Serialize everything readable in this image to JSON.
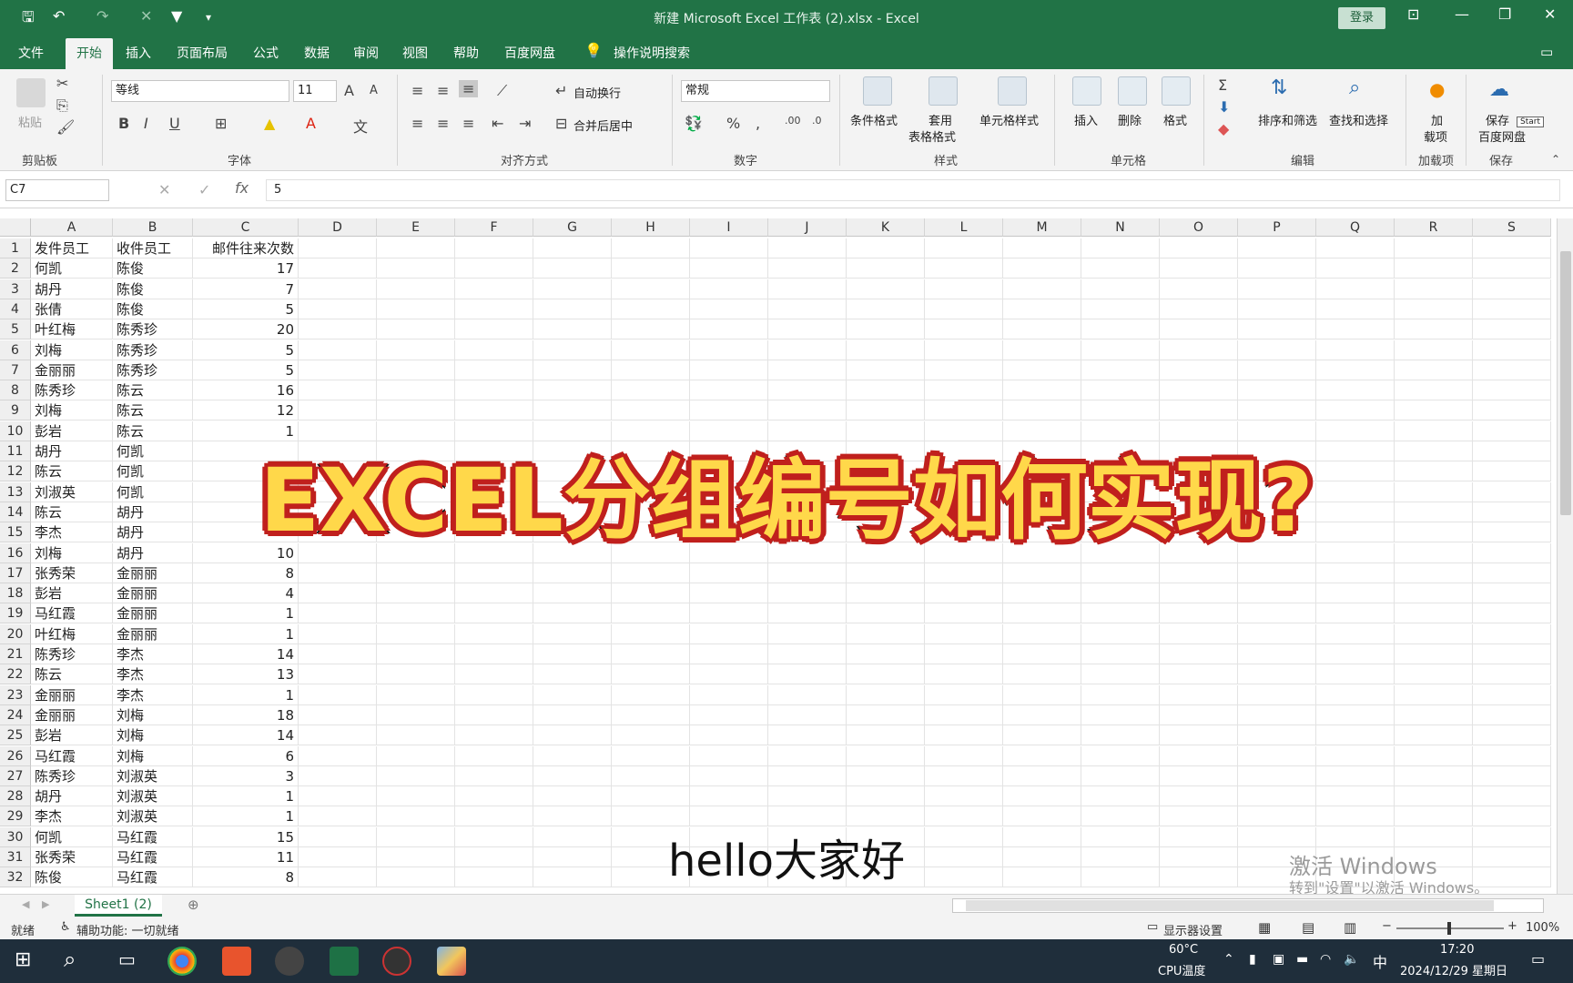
{
  "window": {
    "title": "新建 Microsoft Excel 工作表 (2).xlsx  -  Excel",
    "login_label": "登录"
  },
  "menu": {
    "items": [
      "文件",
      "开始",
      "插入",
      "页面布局",
      "公式",
      "数据",
      "审阅",
      "视图",
      "帮助",
      "百度网盘"
    ],
    "search_label": "操作说明搜索"
  },
  "ribbon": {
    "clipboard": {
      "label": "剪贴板",
      "paste": "粘贴"
    },
    "font": {
      "label": "字体",
      "name": "等线",
      "size": "11"
    },
    "align": {
      "label": "对齐方式",
      "wrap": "自动换行",
      "merge": "合并后居中"
    },
    "number": {
      "label": "数字",
      "format": "常规"
    },
    "styles": {
      "label": "样式",
      "cond": "条件格式",
      "table1": "套用",
      "table2": "表格格式",
      "cell": "单元格样式"
    },
    "cells": {
      "label": "单元格",
      "insert": "插入",
      "delete": "删除",
      "format": "格式"
    },
    "edit": {
      "label": "编辑",
      "sort": "排序和筛选",
      "find": "查找和选择"
    },
    "addins": {
      "label": "加载项",
      "btn1": "加",
      "btn2": "载项"
    },
    "save": {
      "label": "保存",
      "btn1": "保存",
      "btn2": "百度网盘",
      "tooltip": "Start"
    }
  },
  "formula": {
    "namebox": "C7",
    "value": "5"
  },
  "columns": [
    "A",
    "B",
    "C",
    "D",
    "E",
    "F",
    "G",
    "H",
    "I",
    "J",
    "K",
    "L",
    "M",
    "N",
    "O",
    "P",
    "Q",
    "R",
    "S"
  ],
  "header_row": [
    "发件员工",
    "收件员工",
    "邮件往来次数"
  ],
  "rows": [
    [
      "何凯",
      "陈俊",
      "17"
    ],
    [
      "胡丹",
      "陈俊",
      "7"
    ],
    [
      "张倩",
      "陈俊",
      "5"
    ],
    [
      "叶红梅",
      "陈秀珍",
      "20"
    ],
    [
      "刘梅",
      "陈秀珍",
      "5"
    ],
    [
      "金丽丽",
      "陈秀珍",
      "5"
    ],
    [
      "陈秀珍",
      "陈云",
      "16"
    ],
    [
      "刘梅",
      "陈云",
      "12"
    ],
    [
      "彭岩",
      "陈云",
      "1"
    ],
    [
      "胡丹",
      "何凯",
      ""
    ],
    [
      "陈云",
      "何凯",
      ""
    ],
    [
      "刘淑英",
      "何凯",
      ""
    ],
    [
      "陈云",
      "胡丹",
      ""
    ],
    [
      "李杰",
      "胡丹",
      ""
    ],
    [
      "刘梅",
      "胡丹",
      "10"
    ],
    [
      "张秀荣",
      "金丽丽",
      "8"
    ],
    [
      "彭岩",
      "金丽丽",
      "4"
    ],
    [
      "马红霞",
      "金丽丽",
      "1"
    ],
    [
      "叶红梅",
      "金丽丽",
      "1"
    ],
    [
      "陈秀珍",
      "李杰",
      "14"
    ],
    [
      "陈云",
      "李杰",
      "13"
    ],
    [
      "金丽丽",
      "李杰",
      "1"
    ],
    [
      "金丽丽",
      "刘梅",
      "18"
    ],
    [
      "彭岩",
      "刘梅",
      "14"
    ],
    [
      "马红霞",
      "刘梅",
      "6"
    ],
    [
      "陈秀珍",
      "刘淑英",
      "3"
    ],
    [
      "胡丹",
      "刘淑英",
      "1"
    ],
    [
      "李杰",
      "刘淑英",
      "1"
    ],
    [
      "何凯",
      "马红霞",
      "15"
    ],
    [
      "张秀荣",
      "马红霞",
      "11"
    ],
    [
      "陈俊",
      "马红霞",
      "8"
    ]
  ],
  "row_numbers": [
    "1",
    "2",
    "3",
    "4",
    "5",
    "6",
    "7",
    "8",
    "9",
    "10",
    "11",
    "12",
    "13",
    "14",
    "15",
    "16",
    "17",
    "18",
    "19",
    "20",
    "21",
    "22",
    "23",
    "24",
    "25",
    "26",
    "27",
    "28",
    "29",
    "30",
    "31",
    "32"
  ],
  "sheet": {
    "tab": "Sheet1 (2)"
  },
  "status": {
    "ready": "就绪",
    "accessibility": "辅助功能: 一切就绪",
    "display": "显示器设置",
    "zoom": "100%"
  },
  "overlay": {
    "title": "EXCEL分组编号如何实现?",
    "subtitle": "hello大家好"
  },
  "watermark": {
    "line1": "激活 Windows",
    "line2": "转到\"设置\"以激活 Windows。"
  },
  "taskbar": {
    "temp": "60°C",
    "temp_label": "CPU温度",
    "ime": "中",
    "time": "17:20",
    "date": "2024/12/29 星期日"
  },
  "colors": {
    "excel_green": "#217346",
    "overlay_yellow": "#ffd84a",
    "overlay_red": "#c0201d"
  }
}
